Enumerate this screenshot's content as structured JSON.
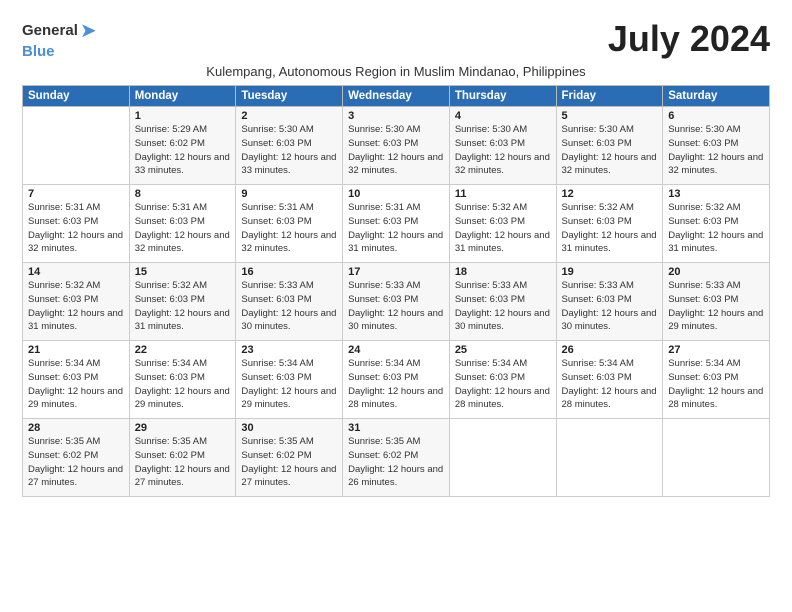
{
  "logo": {
    "general": "General",
    "blue": "Blue"
  },
  "title": "July 2024",
  "subtitle": "Kulempang, Autonomous Region in Muslim Mindanao, Philippines",
  "days_header": [
    "Sunday",
    "Monday",
    "Tuesday",
    "Wednesday",
    "Thursday",
    "Friday",
    "Saturday"
  ],
  "weeks": [
    [
      {
        "num": "",
        "info": ""
      },
      {
        "num": "1",
        "info": "Sunrise: 5:29 AM\nSunset: 6:02 PM\nDaylight: 12 hours\nand 33 minutes."
      },
      {
        "num": "2",
        "info": "Sunrise: 5:30 AM\nSunset: 6:03 PM\nDaylight: 12 hours\nand 33 minutes."
      },
      {
        "num": "3",
        "info": "Sunrise: 5:30 AM\nSunset: 6:03 PM\nDaylight: 12 hours\nand 32 minutes."
      },
      {
        "num": "4",
        "info": "Sunrise: 5:30 AM\nSunset: 6:03 PM\nDaylight: 12 hours\nand 32 minutes."
      },
      {
        "num": "5",
        "info": "Sunrise: 5:30 AM\nSunset: 6:03 PM\nDaylight: 12 hours\nand 32 minutes."
      },
      {
        "num": "6",
        "info": "Sunrise: 5:30 AM\nSunset: 6:03 PM\nDaylight: 12 hours\nand 32 minutes."
      }
    ],
    [
      {
        "num": "7",
        "info": "Sunrise: 5:31 AM\nSunset: 6:03 PM\nDaylight: 12 hours\nand 32 minutes."
      },
      {
        "num": "8",
        "info": "Sunrise: 5:31 AM\nSunset: 6:03 PM\nDaylight: 12 hours\nand 32 minutes."
      },
      {
        "num": "9",
        "info": "Sunrise: 5:31 AM\nSunset: 6:03 PM\nDaylight: 12 hours\nand 32 minutes."
      },
      {
        "num": "10",
        "info": "Sunrise: 5:31 AM\nSunset: 6:03 PM\nDaylight: 12 hours\nand 31 minutes."
      },
      {
        "num": "11",
        "info": "Sunrise: 5:32 AM\nSunset: 6:03 PM\nDaylight: 12 hours\nand 31 minutes."
      },
      {
        "num": "12",
        "info": "Sunrise: 5:32 AM\nSunset: 6:03 PM\nDaylight: 12 hours\nand 31 minutes."
      },
      {
        "num": "13",
        "info": "Sunrise: 5:32 AM\nSunset: 6:03 PM\nDaylight: 12 hours\nand 31 minutes."
      }
    ],
    [
      {
        "num": "14",
        "info": "Sunrise: 5:32 AM\nSunset: 6:03 PM\nDaylight: 12 hours\nand 31 minutes."
      },
      {
        "num": "15",
        "info": "Sunrise: 5:32 AM\nSunset: 6:03 PM\nDaylight: 12 hours\nand 31 minutes."
      },
      {
        "num": "16",
        "info": "Sunrise: 5:33 AM\nSunset: 6:03 PM\nDaylight: 12 hours\nand 30 minutes."
      },
      {
        "num": "17",
        "info": "Sunrise: 5:33 AM\nSunset: 6:03 PM\nDaylight: 12 hours\nand 30 minutes."
      },
      {
        "num": "18",
        "info": "Sunrise: 5:33 AM\nSunset: 6:03 PM\nDaylight: 12 hours\nand 30 minutes."
      },
      {
        "num": "19",
        "info": "Sunrise: 5:33 AM\nSunset: 6:03 PM\nDaylight: 12 hours\nand 30 minutes."
      },
      {
        "num": "20",
        "info": "Sunrise: 5:33 AM\nSunset: 6:03 PM\nDaylight: 12 hours\nand 29 minutes."
      }
    ],
    [
      {
        "num": "21",
        "info": "Sunrise: 5:34 AM\nSunset: 6:03 PM\nDaylight: 12 hours\nand 29 minutes."
      },
      {
        "num": "22",
        "info": "Sunrise: 5:34 AM\nSunset: 6:03 PM\nDaylight: 12 hours\nand 29 minutes."
      },
      {
        "num": "23",
        "info": "Sunrise: 5:34 AM\nSunset: 6:03 PM\nDaylight: 12 hours\nand 29 minutes."
      },
      {
        "num": "24",
        "info": "Sunrise: 5:34 AM\nSunset: 6:03 PM\nDaylight: 12 hours\nand 28 minutes."
      },
      {
        "num": "25",
        "info": "Sunrise: 5:34 AM\nSunset: 6:03 PM\nDaylight: 12 hours\nand 28 minutes."
      },
      {
        "num": "26",
        "info": "Sunrise: 5:34 AM\nSunset: 6:03 PM\nDaylight: 12 hours\nand 28 minutes."
      },
      {
        "num": "27",
        "info": "Sunrise: 5:34 AM\nSunset: 6:03 PM\nDaylight: 12 hours\nand 28 minutes."
      }
    ],
    [
      {
        "num": "28",
        "info": "Sunrise: 5:35 AM\nSunset: 6:02 PM\nDaylight: 12 hours\nand 27 minutes."
      },
      {
        "num": "29",
        "info": "Sunrise: 5:35 AM\nSunset: 6:02 PM\nDaylight: 12 hours\nand 27 minutes."
      },
      {
        "num": "30",
        "info": "Sunrise: 5:35 AM\nSunset: 6:02 PM\nDaylight: 12 hours\nand 27 minutes."
      },
      {
        "num": "31",
        "info": "Sunrise: 5:35 AM\nSunset: 6:02 PM\nDaylight: 12 hours\nand 26 minutes."
      },
      {
        "num": "",
        "info": ""
      },
      {
        "num": "",
        "info": ""
      },
      {
        "num": "",
        "info": ""
      }
    ]
  ]
}
